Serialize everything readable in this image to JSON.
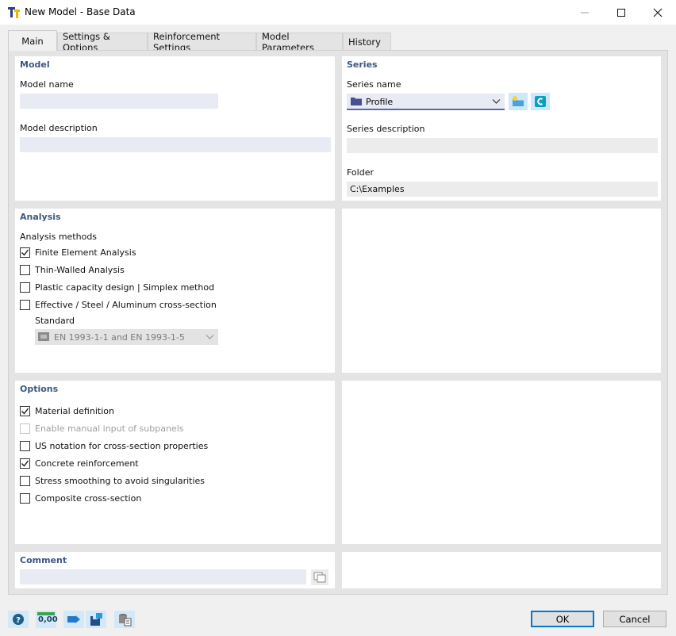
{
  "window": {
    "title": "New Model - Base Data"
  },
  "tabs": [
    {
      "label": "Main"
    },
    {
      "label": "Settings & Options"
    },
    {
      "label": "Reinforcement Settings"
    },
    {
      "label": "Model Parameters"
    },
    {
      "label": "History"
    }
  ],
  "model": {
    "title": "Model",
    "name_label": "Model name",
    "name_value": "",
    "description_label": "Model description",
    "description_value": ""
  },
  "series": {
    "title": "Series",
    "name_label": "Series name",
    "name_value": "Profile",
    "description_label": "Series description",
    "description_value": "",
    "folder_label": "Folder",
    "folder_value": "C:\\Examples"
  },
  "analysis": {
    "title": "Analysis",
    "methods_label": "Analysis methods",
    "methods": [
      {
        "label": "Finite Element Analysis",
        "checked": true
      },
      {
        "label": "Thin-Walled Analysis",
        "checked": false
      },
      {
        "label": "Plastic capacity design | Simplex method",
        "checked": false
      },
      {
        "label": "Effective / Steel / Aluminum cross-section",
        "checked": false
      }
    ],
    "standard_label": "Standard",
    "standard_value": "EN 1993-1-1 and EN 1993-1-5"
  },
  "options": {
    "title": "Options",
    "items": [
      {
        "label": "Material definition",
        "checked": true,
        "disabled": false
      },
      {
        "label": "Enable manual input of subpanels",
        "checked": false,
        "disabled": true
      },
      {
        "label": "US notation for cross-section properties",
        "checked": false,
        "disabled": false
      },
      {
        "label": "Concrete reinforcement",
        "checked": true,
        "disabled": false
      },
      {
        "label": "Stress smoothing to avoid singularities",
        "checked": false,
        "disabled": false
      },
      {
        "label": "Composite cross-section",
        "checked": false,
        "disabled": false
      }
    ]
  },
  "comment": {
    "title": "Comment",
    "value": ""
  },
  "footer": {
    "decimals_label": "0,00",
    "ok_label": "OK",
    "cancel_label": "Cancel"
  },
  "colors": {
    "section_title": "#3d5781",
    "input_bg": "#e8eaf4",
    "accent": "#0078d7"
  }
}
